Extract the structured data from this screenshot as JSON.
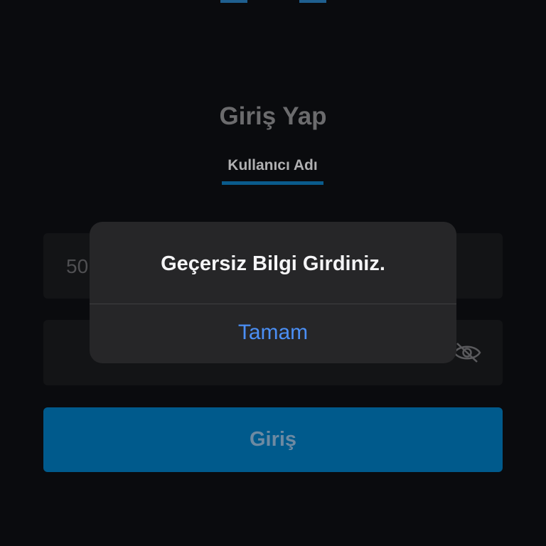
{
  "login": {
    "title": "Giriş Yap",
    "tab_label": "Kullanıcı Adı",
    "phone_value": "50",
    "submit_label": "Giriş"
  },
  "alert": {
    "message": "Geçersiz Bilgi Girdiniz.",
    "ok_label": "Tamam"
  },
  "icons": {
    "password_toggle": "eye-slash-icon"
  },
  "colors": {
    "background": "#0a0b0e",
    "accent": "#005a8c",
    "alert_link": "#4b8ff5"
  }
}
